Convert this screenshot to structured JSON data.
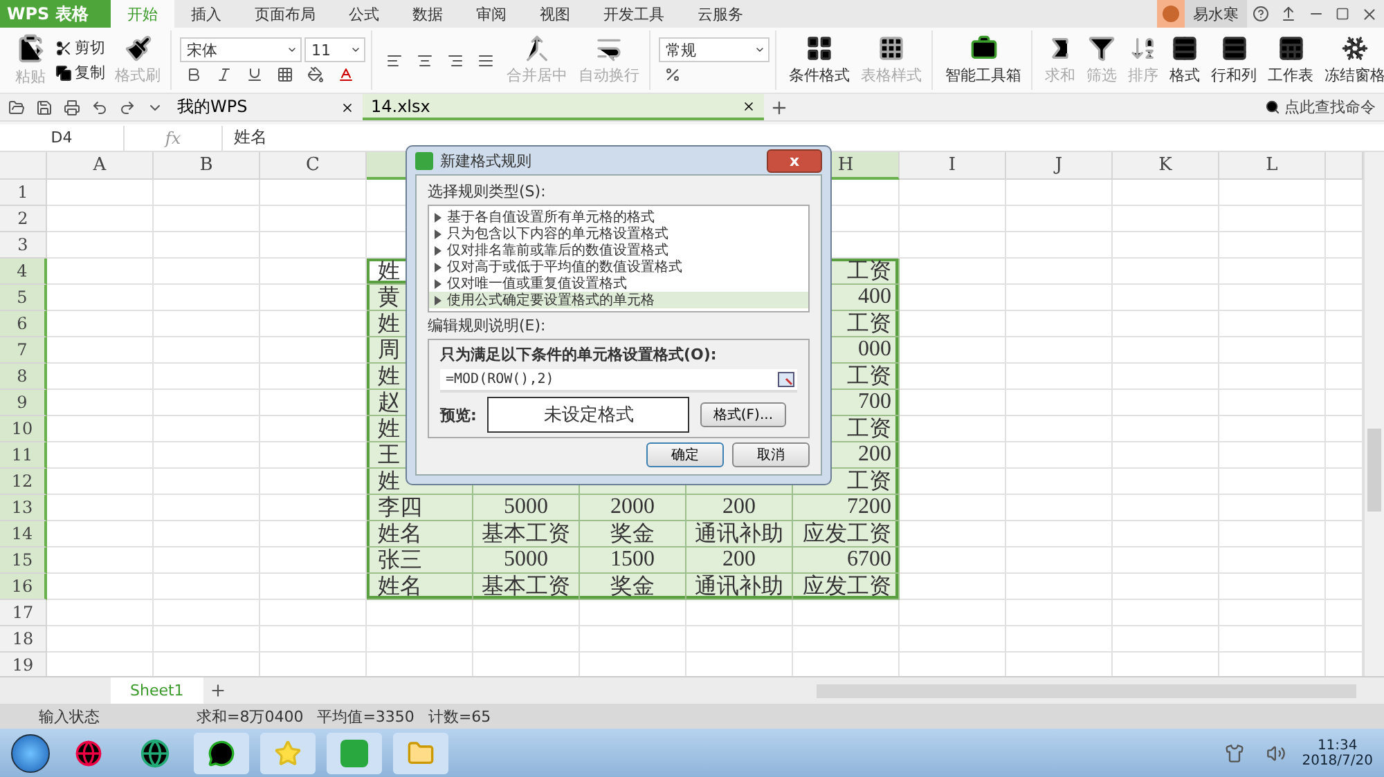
{
  "app_menu": {
    "label": "WPS 表格"
  },
  "tabs": [
    {
      "label": "开始",
      "selected": true
    },
    {
      "label": "插入",
      "selected": false
    },
    {
      "label": "页面布局",
      "selected": false
    },
    {
      "label": "公式",
      "selected": false
    },
    {
      "label": "数据",
      "selected": false
    },
    {
      "label": "审阅",
      "selected": false
    },
    {
      "label": "视图",
      "selected": false
    },
    {
      "label": "开发工具",
      "selected": false
    },
    {
      "label": "云服务",
      "selected": false
    }
  ],
  "user": {
    "name": "易水寒"
  },
  "ribbon": {
    "paste": {
      "label": "粘贴",
      "disabled": true
    },
    "cut": {
      "label": "剪切",
      "disabled": false
    },
    "copy": {
      "label": "复制",
      "disabled": false
    },
    "format_painter": {
      "label": "格式刷",
      "disabled": true
    },
    "font": {
      "name": "宋体",
      "size": "11"
    },
    "merge": {
      "label": "合并居中",
      "disabled": true
    },
    "wrap": {
      "label": "自动换行",
      "disabled": true
    },
    "number_format": "常规",
    "styles": [
      {
        "label": "条件格式",
        "disabled": false
      },
      {
        "label": "表格样式",
        "disabled": true
      }
    ],
    "toolbox": {
      "label": "智能工具箱",
      "disabled": false
    },
    "editing": [
      {
        "label": "求和",
        "disabled": true
      },
      {
        "label": "筛选",
        "disabled": true
      },
      {
        "label": "排序",
        "disabled": true
      },
      {
        "label": "格式",
        "disabled": false
      },
      {
        "label": "行和列",
        "disabled": false
      },
      {
        "label": "工作表",
        "disabled": false
      },
      {
        "label": "冻结窗格",
        "disabled": false
      }
    ]
  },
  "doc_tabs": [
    {
      "label": "我的WPS",
      "selected": false
    },
    {
      "label": "14.xlsx",
      "selected": true
    }
  ],
  "command_search": {
    "placeholder": "点此查找命令"
  },
  "formula_bar": {
    "name_box": "D4",
    "fx": "fx",
    "formula": "姓名"
  },
  "columns": [
    {
      "label": "A",
      "selected": false
    },
    {
      "label": "B",
      "selected": false
    },
    {
      "label": "C",
      "selected": false
    },
    {
      "selected": true
    },
    {},
    {},
    {},
    {
      "label": "H",
      "selected": true
    },
    {
      "label": "I",
      "selected": false
    },
    {
      "label": "J",
      "selected": false
    },
    {
      "label": "K",
      "selected": false
    },
    {
      "label": "L",
      "selected": false
    }
  ],
  "rows": [
    {
      "header": "1",
      "selected": false
    },
    {
      "header": "2",
      "selected": false
    },
    {
      "header": "3",
      "selected": false
    },
    {
      "header": "4",
      "selected": true,
      "cells": {
        "d": {
          "text": "姓",
          "active": true
        },
        "h": {
          "text": "工资",
          "active": false
        }
      }
    },
    {
      "header": "5",
      "selected": true,
      "cells": {
        "d": {
          "text": "黄",
          "active": false
        },
        "h": {
          "text": "400",
          "active": false
        }
      }
    },
    {
      "header": "6",
      "selected": true,
      "cells": {
        "d": {
          "text": "姓",
          "active": false
        },
        "h": {
          "text": "工资",
          "active": false
        }
      }
    },
    {
      "header": "7",
      "selected": true,
      "cells": {
        "d": {
          "text": "周",
          "active": false
        },
        "h": {
          "text": "000",
          "active": false
        }
      }
    },
    {
      "header": "8",
      "selected": true,
      "cells": {
        "d": {
          "text": "姓",
          "active": false
        },
        "h": {
          "text": "工资",
          "active": false
        }
      }
    },
    {
      "header": "9",
      "selected": true,
      "cells": {
        "d": {
          "text": "赵",
          "active": false
        },
        "h": {
          "text": "700",
          "active": false
        }
      }
    },
    {
      "header": "10",
      "selected": true,
      "cells": {
        "d": {
          "text": "姓",
          "active": false
        },
        "h": {
          "text": "工资",
          "active": false
        }
      }
    },
    {
      "header": "11",
      "selected": true,
      "cells": {
        "d": {
          "text": "王",
          "active": false
        },
        "h": {
          "text": "200",
          "active": false
        }
      }
    },
    {
      "header": "12",
      "selected": true,
      "cells": {
        "d": {
          "text": "姓",
          "active": false
        },
        "h": {
          "text": "工资",
          "active": false
        }
      }
    },
    {
      "header": "13",
      "selected": true,
      "cells": {
        "d": {
          "text": "李四",
          "active": false
        },
        "e": {
          "text": "5000",
          "active": false
        },
        "f": {
          "text": "2000",
          "active": false
        },
        "g": {
          "text": "200",
          "active": false
        },
        "h": {
          "text": "7200",
          "active": false
        }
      }
    },
    {
      "header": "14",
      "selected": true,
      "cells": {
        "d": {
          "text": "姓名",
          "active": false
        },
        "e": {
          "text": "基本工资",
          "active": false
        },
        "f": {
          "text": "奖金",
          "active": false
        },
        "g": {
          "text": "通讯补助",
          "active": false
        },
        "h": {
          "text": "应发工资",
          "active": false
        }
      }
    },
    {
      "header": "15",
      "selected": true,
      "cells": {
        "d": {
          "text": "张三",
          "active": false
        },
        "e": {
          "text": "5000",
          "active": false
        },
        "f": {
          "text": "1500",
          "active": false
        },
        "g": {
          "text": "200",
          "active": false
        },
        "h": {
          "text": "6700",
          "active": false
        }
      }
    },
    {
      "header": "16",
      "selected": true,
      "cells": {
        "d": {
          "text": "姓名",
          "active": false
        },
        "e": {
          "text": "基本工资",
          "active": false
        },
        "f": {
          "text": "奖金",
          "active": false
        },
        "g": {
          "text": "通讯补助",
          "active": false
        },
        "h": {
          "text": "应发工资",
          "active": false
        }
      }
    },
    {
      "header": "17",
      "selected": false
    },
    {
      "header": "18",
      "selected": false
    },
    {
      "header": "19",
      "selected": false
    }
  ],
  "sheet_tabs": [
    {
      "label": "Sheet1",
      "selected": true
    }
  ],
  "status_bar": {
    "mode": "输入状态",
    "sum": "求和=8万0400",
    "average": "平均值=3350",
    "count": "计数=65"
  },
  "dialog": {
    "title": "新建格式规则",
    "close": "x",
    "rule_type_label": "选择规则类型(S):",
    "rule_types": [
      {
        "label": "基于各自值设置所有单元格的格式",
        "selected": false
      },
      {
        "label": "只为包含以下内容的单元格设置格式",
        "selected": false
      },
      {
        "label": "仅对排名靠前或靠后的数值设置格式",
        "selected": false
      },
      {
        "label": "仅对高于或低于平均值的数值设置格式",
        "selected": false
      },
      {
        "label": "仅对唯一值或重复值设置格式",
        "selected": false
      },
      {
        "label": "使用公式确定要设置格式的单元格",
        "selected": true
      }
    ],
    "edit_label": "编辑规则说明(E):",
    "condition_label": "只为满足以下条件的单元格设置格式(O):",
    "formula": "=MOD(ROW(),2)",
    "preview_label": "预览:",
    "preview_text": "未设定格式",
    "format_button": "格式(F)...",
    "ok": "确定",
    "cancel": "取消"
  },
  "taskbar": {
    "time": "11:34",
    "date": "2018/7/20"
  }
}
